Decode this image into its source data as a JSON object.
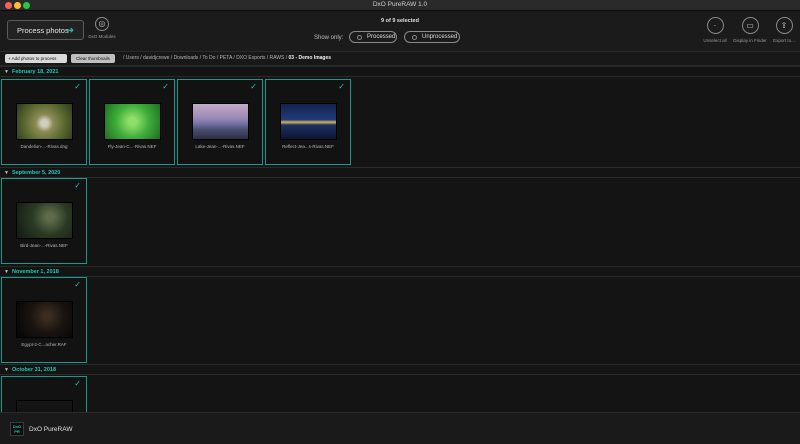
{
  "window": {
    "title": "DxO PureRAW 1.0"
  },
  "toolbar": {
    "process_label": "Process photos",
    "process_icon": "arrow-right-icon",
    "modules_label": "DxO Modules",
    "selection_count": "9 of 9 selected",
    "show_only_label": "Show only:",
    "filter_processed": "Processed",
    "filter_unprocessed": "Unprocessed",
    "unselect_label": "Unselect all",
    "finder_label": "Display in Finder",
    "export_label": "Export to..."
  },
  "pathbar": {
    "add_label": "+ Add photos to process",
    "clear_label": "Clear thumbnails",
    "path": "/ Users / davidjcrewe / Downloads / To Do / PETA / DXO Exports / RAWS / ",
    "current_folder": "03 - Demo Images"
  },
  "groups": [
    {
      "date": "February 18, 2021",
      "photos": [
        {
          "name": "Dandelion-...-Rivas.dng",
          "selected": true
        },
        {
          "name": "Fly-Jean-C...-Rivas.NEF",
          "selected": true
        },
        {
          "name": "Lake-Jean-...-Rivas.NEF",
          "selected": true
        },
        {
          "name": "Reflect-Jea...s-Rivas.NEF",
          "selected": true
        }
      ]
    },
    {
      "date": "September 5, 2020",
      "photos": [
        {
          "name": "Bird-Jean-...-Rivas.NEF",
          "selected": true
        }
      ]
    },
    {
      "date": "November 1, 2018",
      "photos": [
        {
          "name": "Egypt-2-C...acher.RAF",
          "selected": true
        }
      ]
    },
    {
      "date": "October 31, 2018",
      "photos": [
        {
          "name": "",
          "selected": true
        }
      ]
    }
  ],
  "footer": {
    "logo_text": "DxO PR",
    "app_name": "DxO PureRAW"
  },
  "colors": {
    "accent": "#1fc8b6",
    "background": "#141414",
    "tile_border": "#1a9a8e"
  }
}
